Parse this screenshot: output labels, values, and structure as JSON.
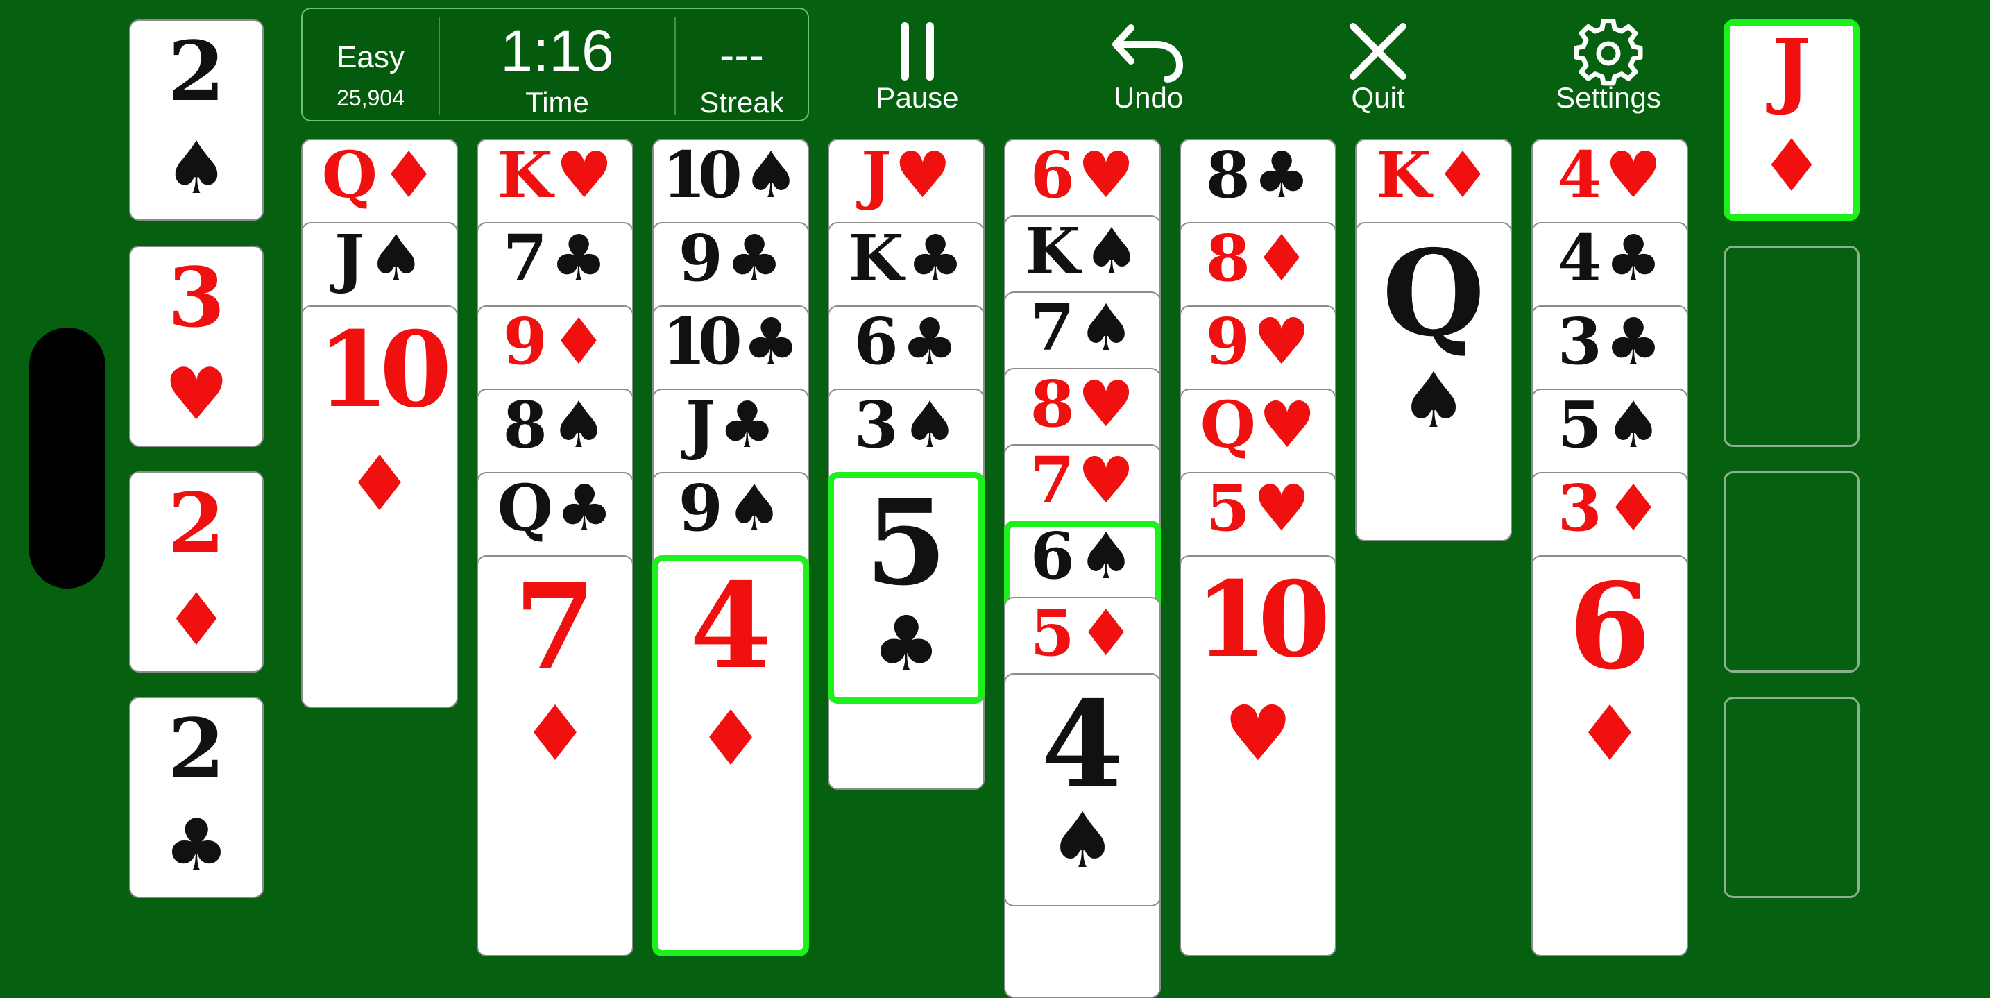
{
  "status": {
    "difficulty": "Easy",
    "game_number": "25,904",
    "time": "1:16",
    "time_label": "Time",
    "streak": "---",
    "streak_label": "Streak"
  },
  "toolbar": {
    "pause": "Pause",
    "undo": "Undo",
    "quit": "Quit",
    "settings": "Settings"
  },
  "foundations": [
    {
      "rank": "2",
      "suit": "♠"
    },
    {
      "rank": "3",
      "suit": "♥"
    },
    {
      "rank": "2",
      "suit": "♦"
    },
    {
      "rank": "2",
      "suit": "♣"
    }
  ],
  "tableau": [
    {
      "cards": [
        {
          "rank": "Q",
          "suit": "♦"
        },
        {
          "rank": "J",
          "suit": "♠"
        },
        {
          "rank": "10",
          "suit": "♦"
        }
      ]
    },
    {
      "cards": [
        {
          "rank": "K",
          "suit": "♥"
        },
        {
          "rank": "7",
          "suit": "♣"
        },
        {
          "rank": "9",
          "suit": "♦"
        },
        {
          "rank": "8",
          "suit": "♠"
        },
        {
          "rank": "Q",
          "suit": "♣"
        },
        {
          "rank": "7",
          "suit": "♦"
        }
      ]
    },
    {
      "cards": [
        {
          "rank": "10",
          "suit": "♠"
        },
        {
          "rank": "9",
          "suit": "♣"
        },
        {
          "rank": "10",
          "suit": "♣"
        },
        {
          "rank": "J",
          "suit": "♣"
        },
        {
          "rank": "9",
          "suit": "♠"
        },
        {
          "rank": "4",
          "suit": "♦",
          "selected": true
        }
      ]
    },
    {
      "cards": [
        {
          "rank": "J",
          "suit": "♥"
        },
        {
          "rank": "K",
          "suit": "♣"
        },
        {
          "rank": "6",
          "suit": "♣"
        },
        {
          "rank": "3",
          "suit": "♠"
        },
        {
          "rank": "5",
          "suit": "♣",
          "selected": true
        }
      ]
    },
    {
      "cards": [
        {
          "rank": "6",
          "suit": "♥"
        },
        {
          "rank": "K",
          "suit": "♠"
        },
        {
          "rank": "7",
          "suit": "♠"
        },
        {
          "rank": "8",
          "suit": "♥"
        },
        {
          "rank": "7",
          "suit": "♥"
        },
        {
          "rank": "6",
          "suit": "♠",
          "selected": true
        },
        {
          "rank": "5",
          "suit": "♦"
        },
        {
          "rank": "4",
          "suit": "♠"
        }
      ]
    },
    {
      "cards": [
        {
          "rank": "8",
          "suit": "♣"
        },
        {
          "rank": "8",
          "suit": "♦"
        },
        {
          "rank": "9",
          "suit": "♥"
        },
        {
          "rank": "Q",
          "suit": "♥"
        },
        {
          "rank": "5",
          "suit": "♥"
        },
        {
          "rank": "10",
          "suit": "♥"
        }
      ]
    },
    {
      "cards": [
        {
          "rank": "K",
          "suit": "♦"
        },
        {
          "rank": "Q",
          "suit": "♠"
        }
      ]
    },
    {
      "cards": [
        {
          "rank": "4",
          "suit": "♥"
        },
        {
          "rank": "4",
          "suit": "♣"
        },
        {
          "rank": "3",
          "suit": "♣"
        },
        {
          "rank": "5",
          "suit": "♠"
        },
        {
          "rank": "3",
          "suit": "♦"
        },
        {
          "rank": "6",
          "suit": "♦"
        }
      ]
    }
  ],
  "free_cells": [
    {
      "rank": "J",
      "suit": "♦",
      "selected": true
    },
    null,
    null,
    null
  ],
  "colors": {
    "felt": "#05610f",
    "red_suit": "#f01010",
    "black_suit": "#111111",
    "highlight": "#1ef01e"
  }
}
